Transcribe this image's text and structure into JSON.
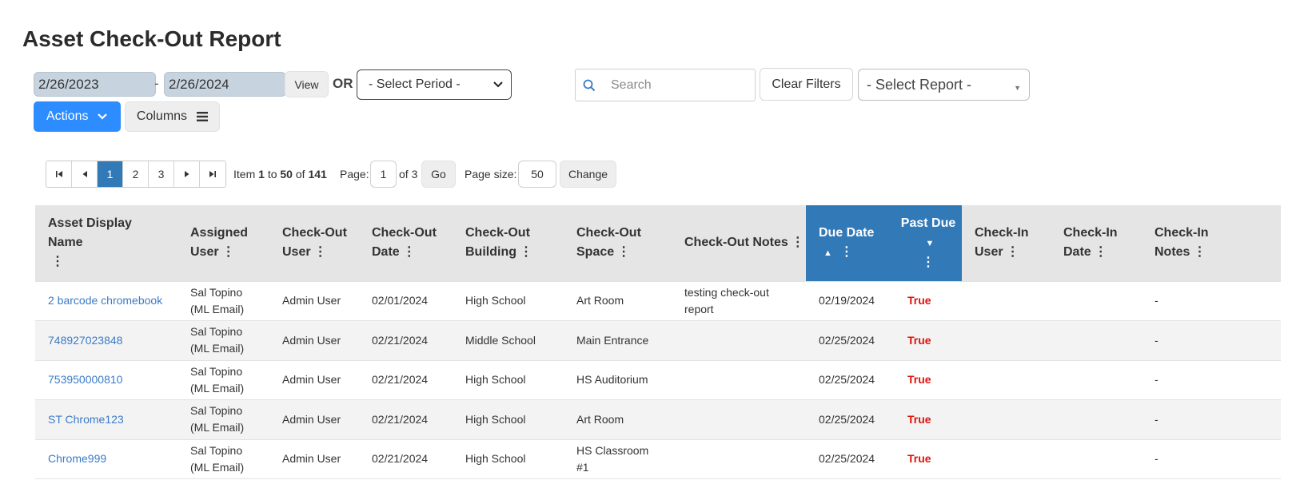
{
  "page": {
    "title": "Asset Check-Out Report"
  },
  "filters": {
    "start_date": "2/26/2023",
    "date_separator": "-",
    "end_date": "2/26/2024",
    "view_label": "View",
    "or_label": "OR",
    "period_placeholder": "- Select Period -",
    "search_placeholder": "Search",
    "clear_filters_label": "Clear Filters",
    "report_placeholder": "- Select Report -"
  },
  "toolbar": {
    "actions_label": "Actions",
    "columns_label": "Columns"
  },
  "pager": {
    "pages": [
      "1",
      "2",
      "3"
    ],
    "active_page": "1",
    "item_label": "Item",
    "item_from": "1",
    "to_label": "to",
    "item_to": "50",
    "of_label": "of",
    "total": "141",
    "page_label": "Page:",
    "page_value": "1",
    "of_pages": "of 3",
    "go_label": "Go",
    "page_size_label": "Page size:",
    "page_size_value": "50",
    "change_label": "Change"
  },
  "table": {
    "columns": [
      {
        "label": "Asset Display Name"
      },
      {
        "label": "Assigned User"
      },
      {
        "label": "Check-Out User"
      },
      {
        "label": "Check-Out Date"
      },
      {
        "label": "Check-Out Building"
      },
      {
        "label": "Check-Out Space"
      },
      {
        "label": "Check-Out Notes"
      },
      {
        "label": "Due Date"
      },
      {
        "label": "Past Due"
      },
      {
        "label": "Check-In User"
      },
      {
        "label": "Check-In Date"
      },
      {
        "label": "Check-In Notes"
      }
    ],
    "rows": [
      {
        "asset": "2 barcode chromebook",
        "assigned_user": "Sal Topino (ML Email)",
        "checkout_user": "Admin User",
        "checkout_date": "02/01/2024",
        "building": "High School",
        "space": "Art Room",
        "notes": "testing check-out report",
        "due_date": "02/19/2024",
        "past_due": "True",
        "checkin_user": "",
        "checkin_date": "",
        "checkin_notes": "-"
      },
      {
        "asset": "748927023848",
        "assigned_user": "Sal Topino (ML Email)",
        "checkout_user": "Admin User",
        "checkout_date": "02/21/2024",
        "building": "Middle School",
        "space": "Main Entrance",
        "notes": "",
        "due_date": "02/25/2024",
        "past_due": "True",
        "checkin_user": "",
        "checkin_date": "",
        "checkin_notes": "-"
      },
      {
        "asset": "753950000810",
        "assigned_user": "Sal Topino (ML Email)",
        "checkout_user": "Admin User",
        "checkout_date": "02/21/2024",
        "building": "High School",
        "space": "HS Auditorium",
        "notes": "",
        "due_date": "02/25/2024",
        "past_due": "True",
        "checkin_user": "",
        "checkin_date": "",
        "checkin_notes": "-"
      },
      {
        "asset": "ST Chrome123",
        "assigned_user": "Sal Topino (ML Email)",
        "checkout_user": "Admin User",
        "checkout_date": "02/21/2024",
        "building": "High School",
        "space": "Art Room",
        "notes": "",
        "due_date": "02/25/2024",
        "past_due": "True",
        "checkin_user": "",
        "checkin_date": "",
        "checkin_notes": "-"
      },
      {
        "asset": "Chrome999",
        "assigned_user": "Sal Topino (ML Email)",
        "checkout_user": "Admin User",
        "checkout_date": "02/21/2024",
        "building": "High School",
        "space": "HS Classroom #1",
        "notes": "",
        "due_date": "02/25/2024",
        "past_due": "True",
        "checkin_user": "",
        "checkin_date": "",
        "checkin_notes": "-"
      }
    ]
  },
  "colors": {
    "primary": "#2d8cff",
    "sorted_header": "#3279b7",
    "link": "#3a7bc8",
    "past_due": "#e0110b"
  }
}
